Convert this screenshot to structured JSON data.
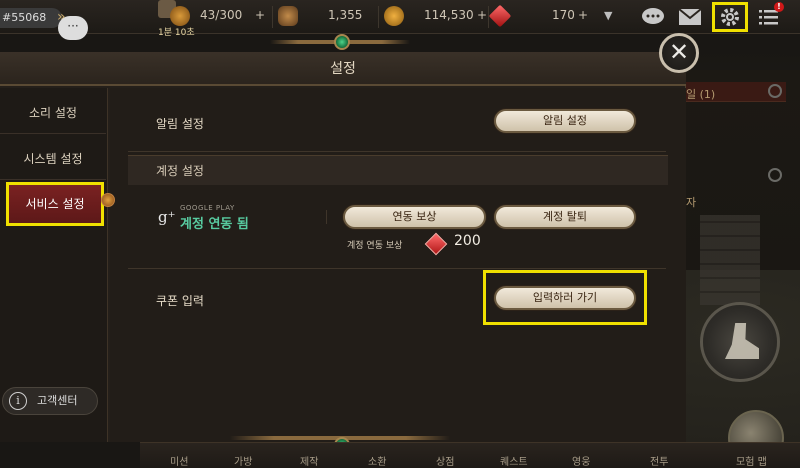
{
  "hud": {
    "player_id": "#55068",
    "time": "1분 10초",
    "resources": [
      {
        "icon": "stamina-icon",
        "value": "43/300",
        "plus": "+"
      },
      {
        "icon": "crystal-ore-icon",
        "value": "1,355"
      },
      {
        "icon": "gold-coin-icon",
        "value": "114,530",
        "plus": "+"
      },
      {
        "icon": "red-gem-icon",
        "value": "170",
        "plus": "+"
      }
    ],
    "notification_badge": "!"
  },
  "panel": {
    "title": "설정",
    "sidebar": {
      "items": [
        {
          "label": "소리 설정"
        },
        {
          "label": "시스템 설정"
        },
        {
          "label": "서비스 설정"
        }
      ],
      "support_label": "고객센터"
    },
    "notifications": {
      "label": "알림 설정",
      "button": "알림 설정"
    },
    "account": {
      "section_title": "계정 설정",
      "provider": "GOOGLE PLAY",
      "status": "계정 연동 됨",
      "link_reward_button": "연동 보상",
      "unlink_button": "계정 탈퇴",
      "reward_label": "계정 연동 보상",
      "reward_amount": "200"
    },
    "coupon": {
      "label": "쿠폰 입력",
      "button": "입력하러 가기"
    }
  },
  "background": {
    "right_text_1": "일 (1)",
    "right_text_2": "자"
  },
  "bottom_nav": {
    "items": [
      "미션",
      "가방",
      "제작",
      "소환",
      "상점",
      "퀘스트",
      "영웅",
      "전투",
      "모험 맵"
    ]
  },
  "colors": {
    "accent_green": "#58cba0",
    "active_tab": "#7a2222",
    "highlight": "#f0e000",
    "gem_red": "#b01818"
  }
}
